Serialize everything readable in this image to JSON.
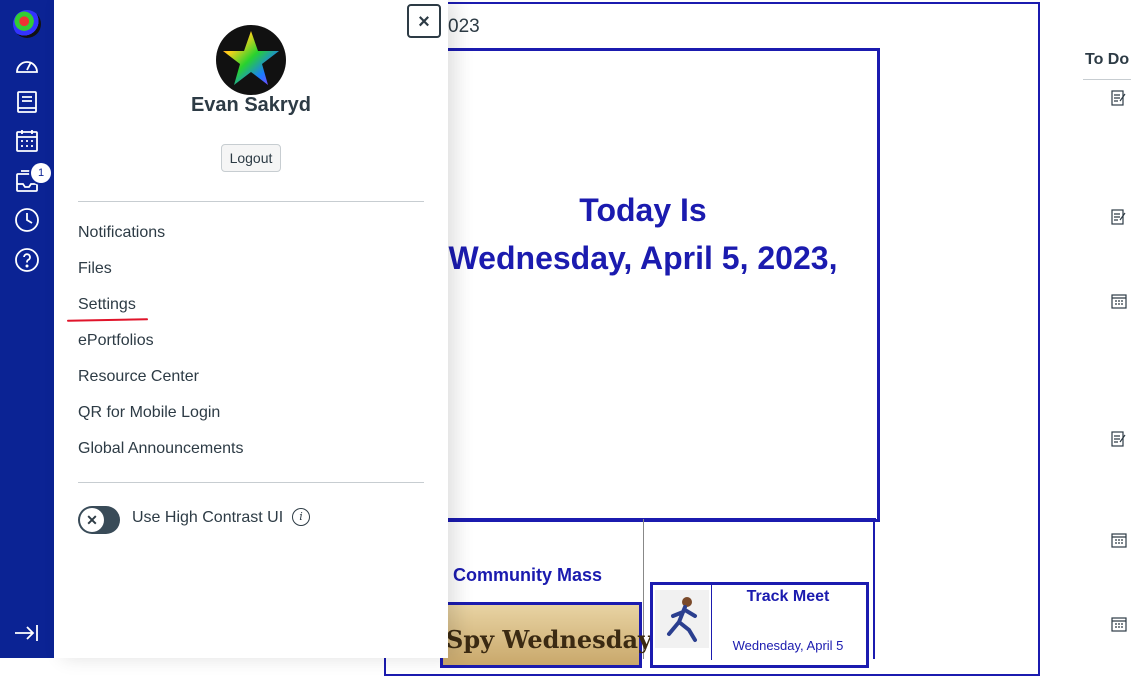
{
  "nav": {
    "badge_count": "1",
    "icons": [
      "dashboard-icon",
      "courses-icon",
      "calendar-icon",
      "inbox-icon",
      "history-icon",
      "help-icon",
      "collapse-nav-icon"
    ]
  },
  "page": {
    "top_year": "023",
    "today_line1": "Today Is",
    "today_line2": "Wednesday, April 5, 2023,",
    "mass_title": "Community Mass",
    "spy_text": "Spy Wednesday",
    "track_title": "Track Meet",
    "track_date": "Wednesday, April 5"
  },
  "todo": {
    "title": "To Do"
  },
  "tray": {
    "close_label": "×",
    "user_name": "Evan Sakryd",
    "logout_label": "Logout",
    "menu": {
      "notifications": "Notifications",
      "files": "Files",
      "settings": "Settings",
      "eportfolios": "ePortfolios",
      "resource_center": "Resource Center",
      "qr_login": "QR for Mobile Login",
      "global_announcements": "Global Announcements"
    },
    "high_contrast_label": "Use High Contrast UI",
    "high_contrast_on": false
  }
}
